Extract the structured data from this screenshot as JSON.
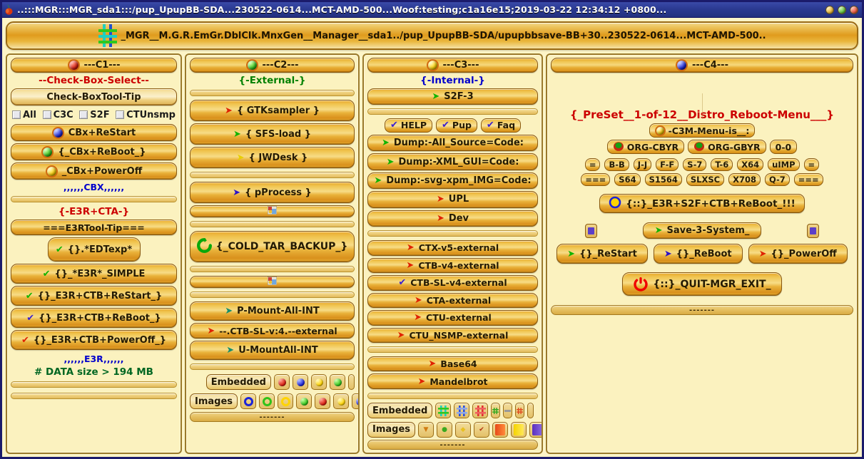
{
  "titlebar": {
    "title": "..:::MGR:::MGR_sda1:::/pup_UpupBB-SDA...230522-0614...MCT-AMD-500...Woof:testing;c1a16e15;2019-03-22 12:34:12 +0800...",
    "buttons": {
      "minimize": "minimize-button",
      "maximize": "maximize-button",
      "close": "close-button"
    }
  },
  "pathbar": {
    "text": "_MGR__M.G.R.EmGr.DblClk.MnxGen__Manager__sda1../pup_UpupBB-SDA/upupbbsave-BB+30..230522-0614...MCT-AMD-500.."
  },
  "c1": {
    "header": "---C1---",
    "subtitle": "--Check-Box-Select--",
    "tooltip_btn": "Check-BoxTool-Tip",
    "checkboxes": [
      {
        "label": "All",
        "checked": false
      },
      {
        "label": "C3C",
        "checked": false
      },
      {
        "label": "S2F",
        "checked": false
      },
      {
        "label": "CTUnsmp",
        "checked": false
      }
    ],
    "buttons": [
      {
        "label": "CBx+ReStart",
        "icon": "blue-marble"
      },
      {
        "label": "{_CBx+ReBoot_}",
        "icon": "green-marble"
      },
      {
        "label": "_CBx+PowerOff",
        "icon": "yellow-marble"
      }
    ],
    "cbx_footer": ",,,,,,CBX,,,,,,",
    "e3r_title": "{-E3R+CTA-}",
    "e3r_tooltip": "===E3RTool-Tip===",
    "e3r_buttons": [
      {
        "label": "{}.*EDTexp*",
        "icon": "green-check"
      },
      {
        "label": "{}_*E3R*_SIMPLE",
        "icon": "green-check"
      },
      {
        "label": "{}_E3R+CTB+ReStart_}",
        "icon": "green-check"
      },
      {
        "label": "{}_E3R+CTB+ReBoot_}",
        "icon": "blue-check"
      },
      {
        "label": "{}_E3R+CTB+PowerOff_}",
        "icon": "red-check"
      }
    ],
    "e3r_footer": ",,,,,,E3R,,,,,,",
    "data_size": "# DATA size > 194 MB"
  },
  "c2": {
    "header": "---C2---",
    "subtitle": "{-External-}",
    "buttons": [
      {
        "label": "{ GTKsampler }",
        "icon": "red-arrow"
      },
      {
        "label": "{ SFS-load }",
        "icon": "green-arrow"
      },
      {
        "label": "{ JWDesk }",
        "icon": "yellow-arrow"
      },
      {
        "label": "{ pProcess }",
        "icon": "blue-arrow"
      }
    ],
    "cold_backup": "{_COLD_TAR_BACKUP_}",
    "mount_buttons": [
      {
        "label": "P-Mount-All-INT",
        "icon": "teal-arrow"
      },
      {
        "label": "--.CTB-SL-v:4.--external",
        "icon": "red-arrow"
      },
      {
        "label": "U-MountAll-INT",
        "icon": "teal-arrow"
      }
    ],
    "embedded_label": "Embedded",
    "images_label": "Images",
    "embedded_swatches": [
      "red",
      "blue",
      "yellow",
      "green"
    ],
    "images_swatches": [
      "blue-ring",
      "green-ring",
      "yellow-ring",
      "green",
      "red",
      "yellow",
      "blue"
    ],
    "footer_dots": "-------"
  },
  "c3": {
    "header": "---C3---",
    "subtitle": "{-Internal-}",
    "s2f": "S2F-3",
    "help_group": [
      {
        "label": "HELP",
        "icon": "blue-check"
      },
      {
        "label": "Pup",
        "icon": "blue-check"
      },
      {
        "label": "Faq",
        "icon": "blue-check"
      }
    ],
    "dump_buttons": [
      {
        "label": "Dump:-All_Source=Code:",
        "icon": "green-arrow"
      },
      {
        "label": "Dump:-XML_GUI=Code:",
        "icon": "green-arrow"
      },
      {
        "label": "Dump:-svg-xpm_IMG=Code:",
        "icon": "green-arrow"
      },
      {
        "label": "UPL",
        "icon": "red-arrow"
      },
      {
        "label": "Dev",
        "icon": "red-arrow"
      }
    ],
    "external_buttons": [
      {
        "label": "CTX-v5-external",
        "icon": "red-arrow"
      },
      {
        "label": "CTB-v4-external",
        "icon": "red-arrow"
      },
      {
        "label": "CTB-SL-v4-external",
        "icon": "blue-check"
      },
      {
        "label": "CTA-external",
        "icon": "red-arrow"
      },
      {
        "label": "CTU-external",
        "icon": "red-arrow"
      },
      {
        "label": "CTU_NSMP-external",
        "icon": "red-arrow"
      }
    ],
    "extra_buttons": [
      {
        "label": "Base64",
        "icon": "red-arrow"
      },
      {
        "label": "Mandelbrot",
        "icon": "red-arrow"
      }
    ],
    "embedded_label": "Embedded",
    "images_label": "Images",
    "footer_dots": "-------"
  },
  "c4": {
    "header": "---C4---",
    "preset_title": "{_PreSet__1-of-12__Distro_Reboot-Menu___}",
    "menu_is": "-C3M-Menu-is__:",
    "org_buttons": [
      {
        "label": "ORG-CBYR",
        "icon": "green-red-marble"
      },
      {
        "label": "ORG-GBYR",
        "icon": "green-red-marble"
      }
    ],
    "zero_label": "0-0",
    "row1": [
      "=",
      "B-B",
      "J-J",
      "F-F",
      "S-7",
      "T-6",
      "X64",
      "uIMP",
      "="
    ],
    "row2": [
      "===",
      "S64",
      "S1564",
      "SLXSC",
      "X708",
      "Q-7",
      "==="
    ],
    "e3r_reboot": "{::}_E3R+S2F+CTB+ReBoot_!!!",
    "save_system": "Save-3-System_",
    "action_buttons": [
      {
        "label": "{}_ReStart",
        "icon": "green-arrow"
      },
      {
        "label": "{}_ReBoot",
        "icon": "blue-arrow"
      },
      {
        "label": "{}_PowerOff",
        "icon": "red-arrow"
      }
    ],
    "quit": "{::}_QUIT-MGR_EXIT_",
    "footer_dots": "-------"
  }
}
